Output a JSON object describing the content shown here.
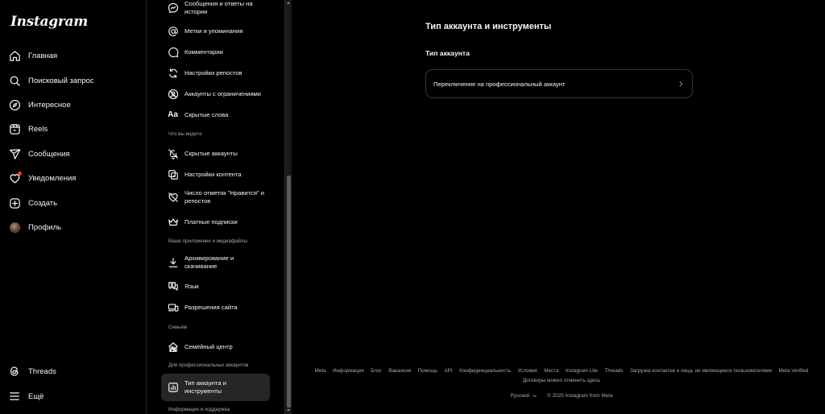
{
  "app": {
    "logo": "Instagram"
  },
  "nav": {
    "items": [
      {
        "label": "Главная",
        "icon": "home-icon"
      },
      {
        "label": "Поисковый запрос",
        "icon": "search-icon"
      },
      {
        "label": "Интересное",
        "icon": "compass-icon"
      },
      {
        "label": "Reels",
        "icon": "reels-icon"
      },
      {
        "label": "Сообщения",
        "icon": "messages-icon"
      },
      {
        "label": "Уведомления",
        "icon": "heart-icon"
      },
      {
        "label": "Создать",
        "icon": "create-icon"
      },
      {
        "label": "Профиль",
        "icon": "avatar"
      }
    ],
    "threads": "Threads",
    "more": "Ещё"
  },
  "settings": {
    "items": [
      {
        "label": "Сообщения и ответы на истории",
        "icon": "messenger-icon"
      },
      {
        "label": "Метки и упоминания",
        "icon": "at-icon"
      },
      {
        "label": "Комментарии",
        "icon": "comment-icon"
      },
      {
        "label": "Настройки репостов",
        "icon": "repost-icon"
      },
      {
        "label": "Аккаунты с ограничениями",
        "icon": "restricted-icon"
      },
      {
        "label": "Скрытые слова",
        "icon": "text-aa-icon"
      },
      {
        "label": "Скрытые аккаунты",
        "icon": "muted-icon"
      },
      {
        "label": "Настройки контента",
        "icon": "content-icon"
      },
      {
        "label": "Число отметок \"Нравится\" и репостов",
        "icon": "heart-off-icon"
      },
      {
        "label": "Платные подписки",
        "icon": "crown-icon"
      },
      {
        "label": "Архивирование и скачивание",
        "icon": "download-icon"
      },
      {
        "label": "Язык",
        "icon": "language-icon"
      },
      {
        "label": "Разрешения сайта",
        "icon": "devices-icon"
      },
      {
        "label": "Семейный центр",
        "icon": "family-icon"
      },
      {
        "label": "Тип аккаунта и инструменты",
        "icon": "chart-icon"
      }
    ],
    "sections": {
      "what_you_see": "Что вы видите",
      "app_media": "Ваше приложение и медиафайлы",
      "family": "Семьям",
      "pro": "Для профессиональных аккаунтов",
      "support": "Информация и поддержка"
    }
  },
  "main": {
    "title": "Тип аккаунта и инструменты",
    "section": "Тип аккаунта",
    "switch_label": "Переключение на профессиональный аккаунт"
  },
  "footer": {
    "links": [
      "Meta",
      "Информация",
      "Блог",
      "Вакансии",
      "Помощь",
      "API",
      "Конфиденциальность",
      "Условия",
      "Места",
      "Instagram Lite",
      "Threads",
      "Загрузка контактов и лица, не являющиеся пользователями",
      "Meta Verified",
      "Договоры можно отменить здесь"
    ],
    "language": "Русский",
    "copyright": "© 2025 Instagram from Meta"
  },
  "colors": {
    "background": "#000000",
    "text": "#f5f5f5",
    "muted": "#a8a8a8",
    "active": "#262626",
    "notification": "#ff3040"
  }
}
